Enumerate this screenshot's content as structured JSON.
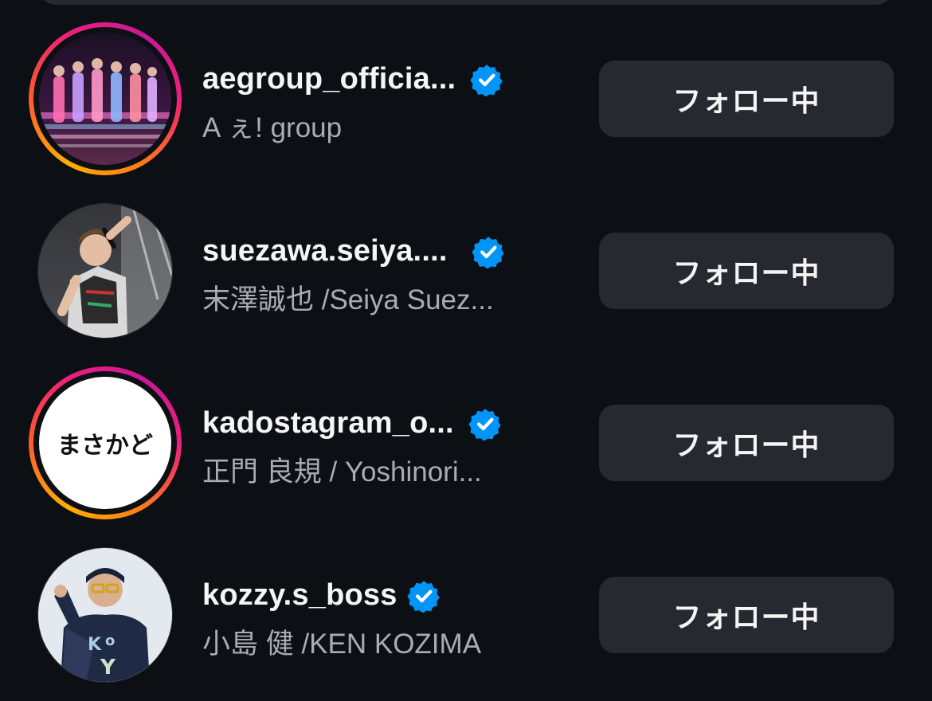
{
  "users": [
    {
      "username": "aegroup_officia...",
      "full_name": "A ぇ! group",
      "verified": true,
      "has_story_ring": true,
      "follow_label": "フォロー中"
    },
    {
      "username": "suezawa.seiya....",
      "full_name": "末澤誠也 /Seiya Suez...",
      "verified": true,
      "has_story_ring": false,
      "follow_label": "フォロー中"
    },
    {
      "username": "kadostagram_o...",
      "full_name": "正門 良規 / Yoshinori...",
      "verified": true,
      "has_story_ring": true,
      "avatar_text": "まさかど",
      "follow_label": "フォロー中"
    },
    {
      "username": "kozzy.s_boss",
      "full_name": "小島 健 /KEN KOZIMA",
      "verified": true,
      "has_story_ring": false,
      "follow_label": "フォロー中"
    }
  ],
  "colors": {
    "background": "#0c1014",
    "button_bg": "#262a30",
    "verified_blue": "#0095f6",
    "secondary_text": "#a8adb3"
  },
  "icons": {
    "verified": "verified-badge-icon"
  }
}
